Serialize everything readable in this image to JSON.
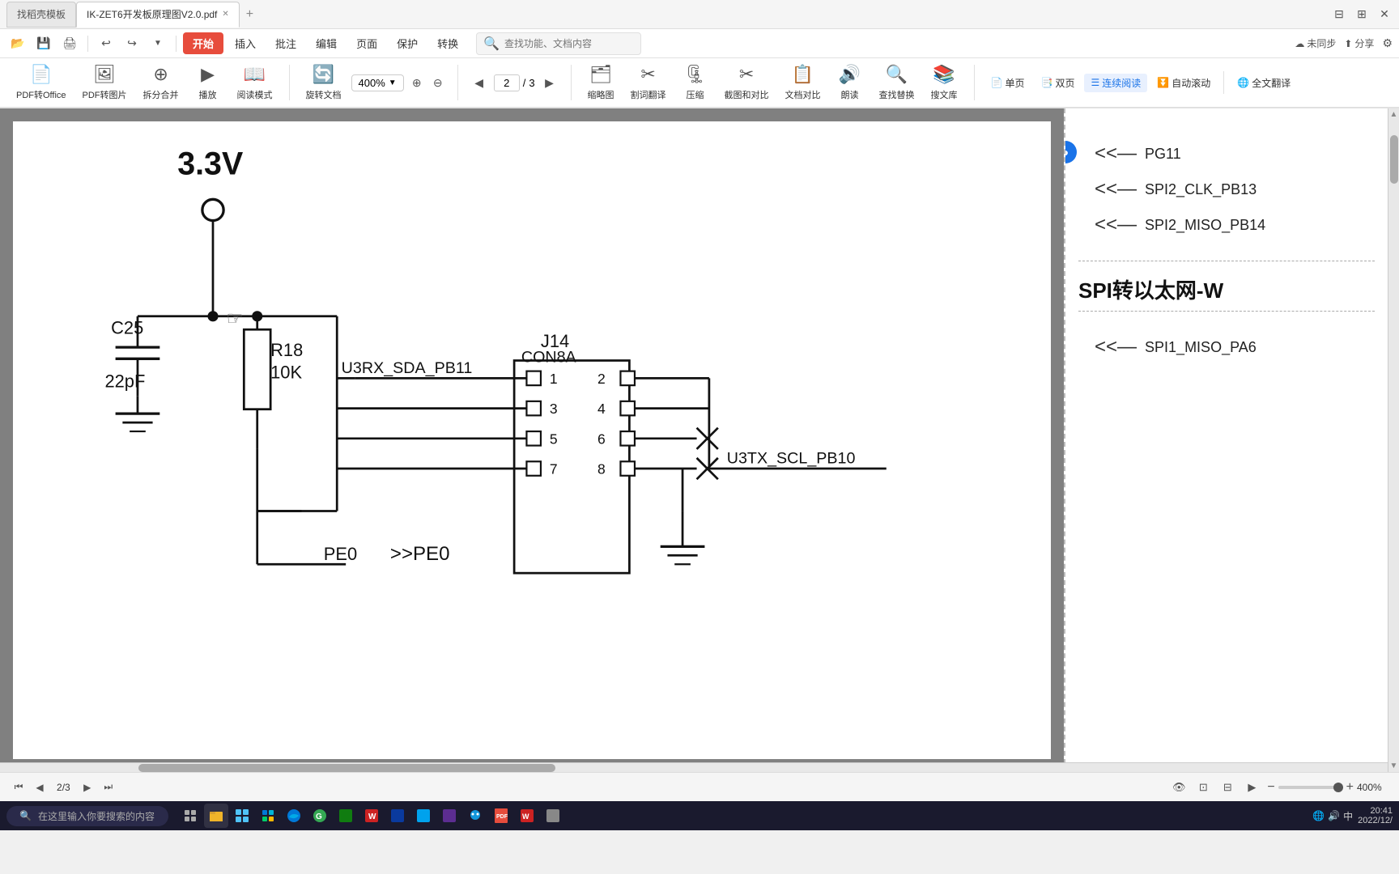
{
  "titlebar": {
    "tab1_label": "找稻壳模板",
    "tab2_label": "IK-ZET6开发板原理图V2.0.pdf",
    "add_tab": "+",
    "icons": [
      "⊞",
      "⊟",
      "✕"
    ]
  },
  "menubar": {
    "icons": [
      "📁",
      "💾",
      "🖨"
    ],
    "undo": "↩",
    "redo": "↪",
    "start_label": "开始",
    "insert_label": "插入",
    "annotate_label": "批注",
    "edit_label": "编辑",
    "page_label": "页面",
    "protect_label": "保护",
    "convert_label": "转换",
    "search_placeholder": "查找功能、文档内容",
    "sync_label": "未同步",
    "share_label": "分享"
  },
  "toolbar": {
    "pdf_to_office_label": "PDF转Office",
    "pdf_to_img_label": "PDF转图片",
    "split_merge_label": "拆分合并",
    "play_label": "播放",
    "read_mode_label": "阅读模式",
    "rotate_doc_label": "旋转文档",
    "zoom_in": "⊕",
    "zoom_out": "⊖",
    "zoom_value": "400%",
    "prev_page": "◀",
    "next_page": "▶",
    "current_page": "2",
    "total_pages": "3",
    "thumbnail_label": "缩略图",
    "cut_label": "割词翻译",
    "compress_label": "压缩",
    "compare_label": "截图和对比",
    "compare2_label": "文档对比",
    "read_label": "朗读",
    "find_replace_label": "查找替换",
    "search_lib_label": "搜文库",
    "single_page_label": "单页",
    "double_page_label": "双页",
    "continuous_label": "连续阅读",
    "auto_scroll_label": "自动滚动",
    "translate_label": "全文翻译"
  },
  "pdf_content": {
    "voltage_label": "3.3V",
    "capacitor_label": "C25",
    "capacitor_value": "22pF",
    "resistor_label": "R18",
    "resistor_value": "10K",
    "connector_label": "J14",
    "connector_type": "CON8A",
    "signal1": "U3RX_SDA_PB11",
    "pin1": "1",
    "pin2": "2",
    "pin3": "3",
    "pin4": "4",
    "pin5": "5",
    "pin6": "6",
    "pin7": "7",
    "pin8": "8",
    "signal2": "U3TX_SCL_PB10",
    "signal3": "PE0",
    "signal4": "PE0"
  },
  "right_panel": {
    "signal1": "PG11",
    "signal2": "SPI2_CLK_PB13",
    "signal3": "SPI2_MISO_PB14",
    "section_title": "SPI转以太网-W",
    "signal4": "SPI1_MISO_PA6"
  },
  "bottom_bar": {
    "page_current": "2",
    "page_total": "3",
    "zoom_level": "400%",
    "zoom_minus": "−",
    "zoom_plus": "+"
  },
  "taskbar": {
    "search_placeholder": "在这里输入你要搜索的内容",
    "time": "20:41",
    "date": "2022/12/",
    "sys_icons": [
      "🔧",
      "🔊",
      "中"
    ]
  }
}
